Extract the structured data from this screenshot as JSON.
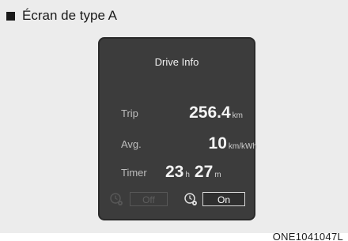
{
  "section": {
    "title": "Écran de type A"
  },
  "screen": {
    "title": "Drive Info",
    "trip": {
      "label": "Trip",
      "value": "256.4",
      "unit": "km"
    },
    "avg": {
      "label": "Avg.",
      "value": "10",
      "unit": "km/kWh"
    },
    "timer": {
      "label": "Timer",
      "hours": "23",
      "hours_unit": "h",
      "minutes": "27",
      "minutes_unit": "m"
    },
    "controls": {
      "off_label": "Off",
      "on_label": "On",
      "left_icon": "clock-gear-icon",
      "right_icon": "clock-gear-icon"
    }
  },
  "figure_code": "ONE1041047L",
  "colors": {
    "background": "#ececec",
    "screen_bg": "#3c3c3c",
    "screen_text": "#f4f4f4",
    "disabled": "#575757"
  }
}
